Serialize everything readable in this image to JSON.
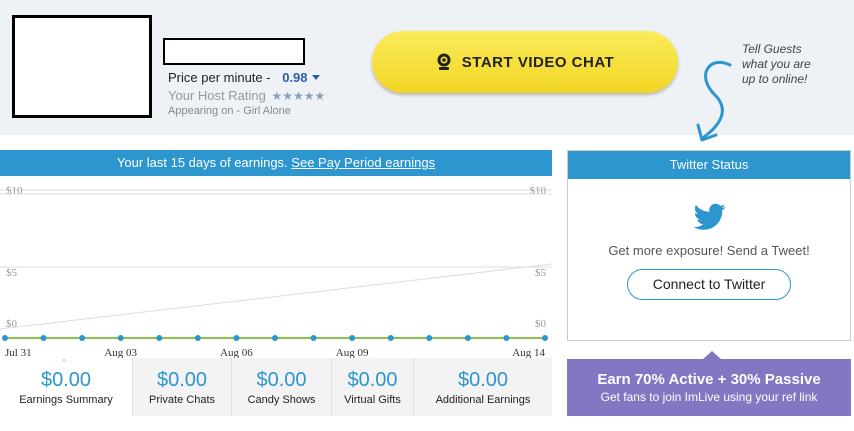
{
  "profile": {
    "price_label": "Price per minute  -",
    "price_value": "0.98",
    "rating_label": "Your Host Rating",
    "rating_stars": "★★★★★",
    "appearing": "Appearing on - Girl Alone"
  },
  "video_chat": {
    "label": "START VIDEO CHAT"
  },
  "tell_guests": {
    "line1": "Tell Guests",
    "line2": "what you are",
    "line3": "up to online!"
  },
  "earnings": {
    "header_text": "Your last 15 days of earnings.",
    "header_link": "See Pay Period earnings",
    "summary": [
      {
        "amount": "$0.00",
        "label": "Earnings Summary"
      },
      {
        "amount": "$0.00",
        "label": "Private Chats"
      },
      {
        "amount": "$0.00",
        "label": "Candy Shows"
      },
      {
        "amount": "$0.00",
        "label": "Virtual Gifts"
      },
      {
        "amount": "$0.00",
        "label": "Additional Earnings"
      }
    ]
  },
  "chart_data": {
    "type": "line",
    "y_ticks": [
      "$10",
      "$5",
      "$0"
    ],
    "ylim": [
      0,
      10
    ],
    "x_tick_labels": [
      "Jul 31",
      "Aug 03",
      "Aug 06",
      "Aug 09",
      "Aug 14"
    ],
    "x": [
      "Jul 31",
      "Aug 01",
      "Aug 02",
      "Aug 03",
      "Aug 04",
      "Aug 05",
      "Aug 06",
      "Aug 07",
      "Aug 08",
      "Aug 09",
      "Aug 10",
      "Aug 11",
      "Aug 12",
      "Aug 13",
      "Aug 14"
    ],
    "series": [
      {
        "values": [
          0,
          0,
          0,
          0,
          0,
          0,
          0,
          0,
          0,
          0,
          0,
          0,
          0,
          0,
          0
        ]
      }
    ],
    "colors": {
      "line": "#8bc34a",
      "point": "#2d96cf",
      "grid": "#dddddd"
    }
  },
  "twitter": {
    "header": "Twitter Status",
    "text": "Get more exposure! Send a Tweet!",
    "button": "Connect to Twitter"
  },
  "promo": {
    "line1": "Earn 70% Active + 30% Passive",
    "line2": "Get fans to join ImLive using your ref link"
  },
  "colors": {
    "accent": "#2d96cf",
    "button_yellow": "#f7df3a",
    "promo_purple": "#8377c4"
  }
}
